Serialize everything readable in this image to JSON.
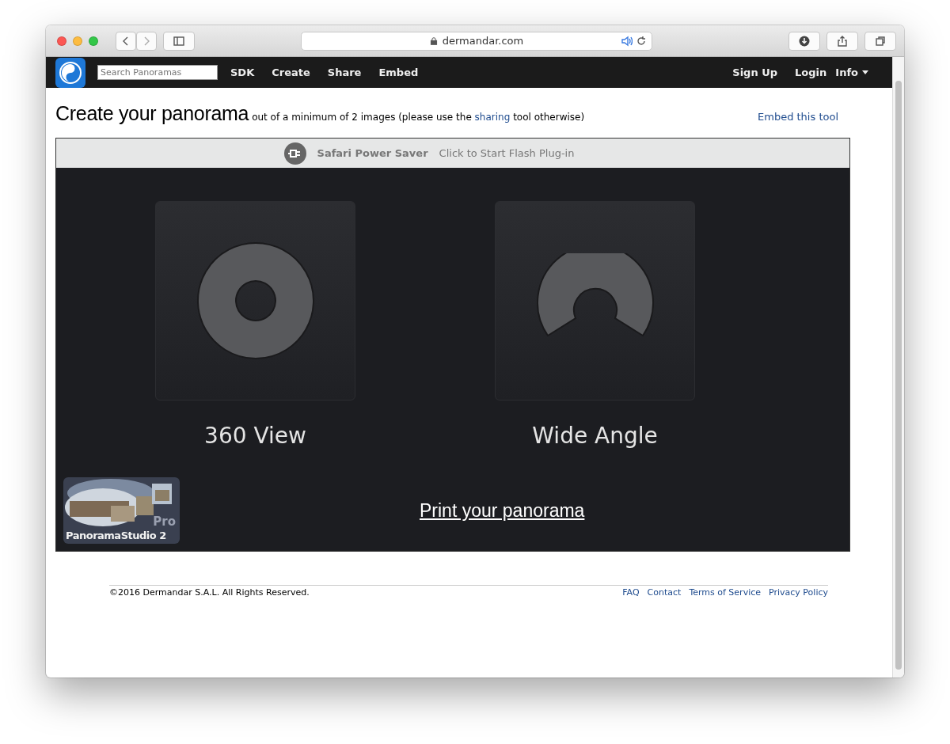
{
  "browser": {
    "url": "dermandar.com"
  },
  "navbar": {
    "search": {
      "placeholder": "Search Panoramas"
    },
    "links": [
      "SDK",
      "Create",
      "Share",
      "Embed"
    ],
    "right_links": [
      "Sign Up",
      "Login"
    ],
    "menu": "Info"
  },
  "heading": {
    "title": "Create your panorama",
    "subtitle_before": "out of a minimum of 2 images (please use the",
    "subtitle_link": "sharing",
    "subtitle_after": "tool otherwise)",
    "embed_link": "Embed this tool"
  },
  "plugin": {
    "power_saver": {
      "title": "Safari Power Saver",
      "message": "Click to Start Flash Plug-in"
    },
    "options": [
      {
        "kind": "ring",
        "label": "360 View"
      },
      {
        "kind": "arc",
        "label": "Wide Angle"
      }
    ],
    "ad": {
      "name": "PanoramaStudio 2",
      "badge": "Pro"
    },
    "print_link": "Print your panorama"
  },
  "footer": {
    "copyright": "©2016 Dermandar S.A.L. All Rights Reserved.",
    "links": [
      "FAQ",
      "Contact",
      "Terms of Service",
      "Privacy Policy"
    ]
  }
}
